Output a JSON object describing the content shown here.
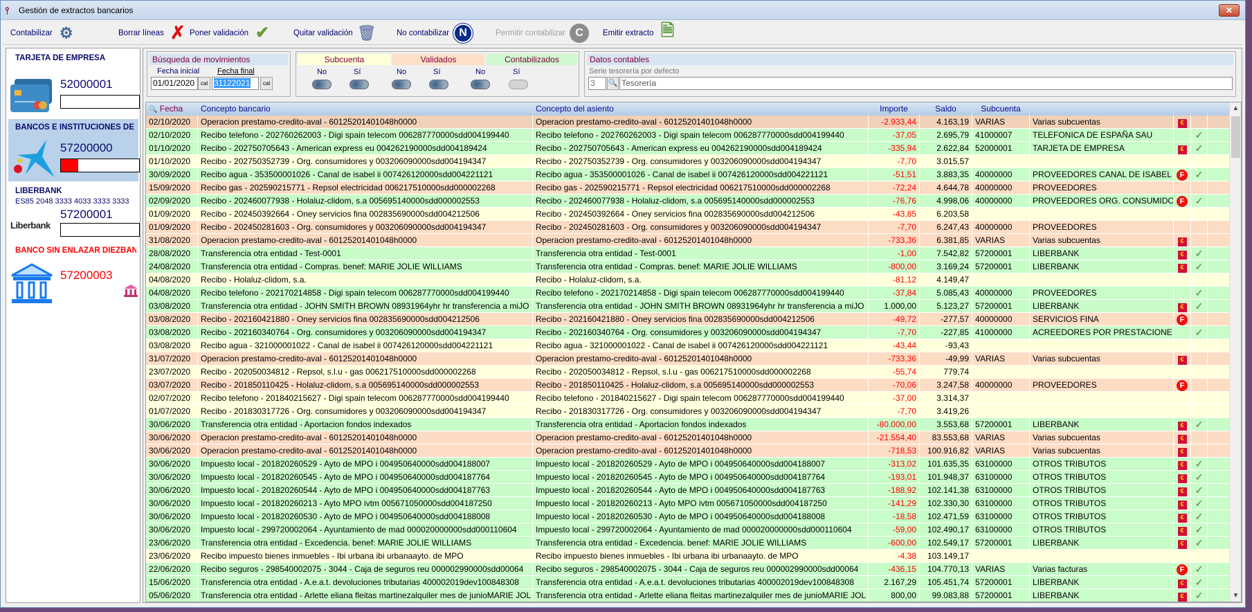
{
  "window": {
    "title": "Gestión de extractos bancarios",
    "close": "✕"
  },
  "toolbar": [
    {
      "label": "Contabilizar",
      "icon": "gears-icon",
      "glyph": "⚙"
    },
    {
      "label": "Borrar líneas",
      "icon": "red-x-icon",
      "glyph": "✗"
    },
    {
      "label": "Poner validación",
      "icon": "check-icon",
      "glyph": "✔"
    },
    {
      "label": "Quitar validación",
      "icon": "trash-icon",
      "glyph": "🗑"
    },
    {
      "label": "No contabilizar",
      "icon": "n-circle-icon",
      "glyph": "N"
    },
    {
      "label": "Permitir contabilizar",
      "icon": "c-circle-icon",
      "glyph": "C",
      "disabled": true
    },
    {
      "label": "Emitir extracto",
      "icon": "document-icon",
      "glyph": "🗎"
    }
  ],
  "accounts": [
    {
      "name": "TARJETA DE EMPRESA",
      "number": "52000001",
      "progress": 0
    },
    {
      "name": "BANCOS E INSTITUCIONES DE CRI",
      "number": "57200000",
      "progress": 0.22
    },
    {
      "name": "LIBERBANK",
      "iban": "ES85 2048 3333 4033 3333 3333",
      "number": "57200001",
      "logo": "Liberbank",
      "progress": 0
    },
    {
      "name": "BANCO SIN ENLAZAR DIEZBANK",
      "number": "57200003"
    }
  ],
  "search": {
    "title": "Búsqueda de movimientos",
    "start_label": "Fecha inicial",
    "start": "01/01/2020",
    "end_label": "Fecha final",
    "end": "31122021",
    "cal": "cal"
  },
  "filters": {
    "subcuenta": "Subcuenta",
    "validados": "Validados",
    "contabilizados": "Contabilizados",
    "no": "No",
    "si": "Sí"
  },
  "datos": {
    "title": "Datos contables",
    "serie_label": "Serie tesorería por defecto",
    "serie": "3",
    "serie_name": "Tesorería"
  },
  "columns": [
    "Fecha",
    "Concepto bancario",
    "Concepto del asiento",
    "Importe",
    "Saldo",
    "Subcuenta"
  ],
  "rows": [
    [
      "02/10/2020",
      "Operacion prestamo-credito-aval - 60125201401048h0000",
      "-2.933,44",
      "4.163,19",
      "VARIAS",
      "Varias subcuentas",
      "E",
      "",
      "selrow"
    ],
    [
      "02/10/2020",
      "Recibo telefono - 202760262003 - Digi spain telecom 006287770000sdd004199440",
      "-37,05",
      "2.695,79",
      "41000007",
      "TELEFONICA DE ESPAÑA SAU",
      "",
      "1",
      "green"
    ],
    [
      "01/10/2020",
      "Recibo - 202750705643 - American express eu 004262190000sdd004189424",
      "-335,94",
      "2.622,84",
      "52000001",
      "TARJETA DE EMPRESA",
      "E",
      "1",
      "green"
    ],
    [
      "01/10/2020",
      "Recibo - 202750352739 - Org. consumidores y 003206090000sdd004194347",
      "-7,70",
      "3.015,57",
      "",
      "",
      "",
      "",
      "yellow"
    ],
    [
      "30/09/2020",
      "Recibo agua - 353500001026 - Canal de isabel ii 007426120000sdd004221121",
      "-51,51",
      "3.883,35",
      "40000000",
      "PROVEEDORES CANAL DE ISABEL II",
      "F",
      "1",
      "green"
    ],
    [
      "15/09/2020",
      "Recibo gas - 202590215771 - Repsol electricidad 006217510000sdd000002268",
      "-72,24",
      "4.644,78",
      "40000000",
      "PROVEEDORES",
      "",
      "",
      "orange"
    ],
    [
      "02/09/2020",
      "Recibo - 202460077938 - Holaluz-clidom, s.a 005695140000sdd000002553",
      "-76,76",
      "4.998,06",
      "40000000",
      "PROVEEDORES ORG. CONSUMIDORES",
      "F",
      "1",
      "green"
    ],
    [
      "01/09/2020",
      "Recibo - 202450392664 - Oney servicios fina 002835690000sdd004212506",
      "-43,85",
      "6.203,58",
      "",
      "",
      "",
      "",
      "yellow"
    ],
    [
      "01/09/2020",
      "Recibo - 202450281603 - Org. consumidores y 003206090000sdd004194347",
      "-7,70",
      "6.247,43",
      "40000000",
      "PROVEEDORES",
      "",
      "",
      "orange"
    ],
    [
      "31/08/2020",
      "Operacion prestamo-credito-aval - 60125201401048h0000",
      "-733,36",
      "6.381,85",
      "VARIAS",
      "Varias subcuentas",
      "E",
      "",
      "orange"
    ],
    [
      "28/08/2020",
      "Transferencia otra entidad - Test-0001",
      "-1,00",
      "7.542,82",
      "57200001",
      "LIBERBANK",
      "E",
      "1",
      "green"
    ],
    [
      "24/08/2020",
      "Transferencia otra entidad - Compras. benef: MARIE JOLIE WILLIAMS",
      "-800,00",
      "3.169,24",
      "57200001",
      "LIBERBANK",
      "E",
      "1",
      "green"
    ],
    [
      "04/08/2020",
      "Recibo - Holaluz-clidom, s.a.",
      "-81,12",
      "4.149,47",
      "",
      "",
      "",
      "",
      "yellow"
    ],
    [
      "04/08/2020",
      "Recibo telefono - 202170214858 - Digi spain telecom 006287770000sdd004199440",
      "-37,84",
      "5.085,43",
      "40000000",
      "PROVEEDORES",
      "",
      "1",
      "green"
    ],
    [
      "03/08/2020",
      "Transferencia otra entidad - JOHN SMITH BROWN 08931964yhr hr transferencia a miJO",
      "1.000,00",
      "5.123,27",
      "57200001",
      "LIBERBANK",
      "E",
      "1",
      "green"
    ],
    [
      "03/08/2020",
      "Recibo - 202160421880 - Oney servicios fina 002835690000sdd004212506",
      "-49,72",
      "-277,57",
      "40000000",
      "SERVICIOS FINA",
      "F",
      "",
      "orange"
    ],
    [
      "03/08/2020",
      "Recibo - 202160340764 - Org. consumidores y 003206090000sdd004194347",
      "-7,70",
      "-227,85",
      "41000000",
      "ACREEDORES POR PRESTACIONES DE S",
      "",
      "1",
      "green"
    ],
    [
      "03/08/2020",
      "Recibo agua - 321000001022 - Canal de isabel ii 007426120000sdd004221121",
      "-43,44",
      "-93,43",
      "",
      "",
      "",
      "",
      "yellow"
    ],
    [
      "31/07/2020",
      "Operacion prestamo-credito-aval - 60125201401048h0000",
      "-733,36",
      "-49,99",
      "VARIAS",
      "Varias subcuentas",
      "E",
      "",
      "orange"
    ],
    [
      "23/07/2020",
      "Recibo - 202050034812 - Repsol, s.l.u - gas 006217510000sdd000002268",
      "-55,74",
      "779,74",
      "",
      "",
      "",
      "",
      "yellow"
    ],
    [
      "03/07/2020",
      "Recibo - 201850110425 - Holaluz-clidom, s.a 005695140000sdd000002553",
      "-70,06",
      "3.247,58",
      "40000000",
      "PROVEEDORES",
      "F",
      "",
      "orange"
    ],
    [
      "02/07/2020",
      "Recibo telefono - 201840215627 - Digi spain telecom 006287770000sdd004199440",
      "-37,00",
      "3.314,37",
      "",
      "",
      "",
      "",
      "yellow"
    ],
    [
      "01/07/2020",
      "Recibo - 201830317726 - Org. consumidores y 003206090000sdd004194347",
      "-7,70",
      "3.419,26",
      "",
      "",
      "",
      "",
      "yellow"
    ],
    [
      "30/06/2020",
      "Transferencia otra entidad - Aportacion fondos indexados",
      "-80.000,00",
      "3.553,68",
      "57200001",
      "LIBERBANK",
      "E",
      "1",
      "green"
    ],
    [
      "30/06/2020",
      "Operacion prestamo-credito-aval - 60125201401048h0000",
      "-21.554,40",
      "83.553,68",
      "VARIAS",
      "Varias subcuentas",
      "E",
      "",
      "orange"
    ],
    [
      "30/06/2020",
      "Operacion prestamo-credito-aval - 60125201401048h0000",
      "-718,53",
      "100.916,82",
      "VARIAS",
      "Varias subcuentas",
      "E",
      "",
      "orange"
    ],
    [
      "30/06/2020",
      "Impuesto local - 201820260529 - Ayto de MPO i 004950640000sdd004188007",
      "-313,02",
      "101.635,35",
      "63100000",
      "OTROS TRIBUTOS",
      "E",
      "1",
      "green"
    ],
    [
      "30/06/2020",
      "Impuesto local - 201820260545 - Ayto de MPO i 004950640000sdd004187764",
      "-193,01",
      "101.948,37",
      "63100000",
      "OTROS TRIBUTOS",
      "E",
      "1",
      "green"
    ],
    [
      "30/06/2020",
      "Impuesto local - 201820260544 - Ayto de MPO i 004950640000sdd004187763",
      "-188,92",
      "102.141,38",
      "63100000",
      "OTROS TRIBUTOS",
      "E",
      "1",
      "green"
    ],
    [
      "30/06/2020",
      "Impuesto local - 201820260213 - Ayto MPO ivtm 005671050000sdd004187250",
      "-141,29",
      "102.330,30",
      "63100000",
      "OTROS TRIBUTOS",
      "E",
      "1",
      "green"
    ],
    [
      "30/06/2020",
      "Impuesto local - 201820260530 - Ayto de MPO i 004950640000sdd004188008",
      "-18,58",
      "102.471,59",
      "63100000",
      "OTROS TRIBUTOS",
      "E",
      "1",
      "green"
    ],
    [
      "30/06/2020",
      "Impuesto local - 299720002064 - Ayuntamiento de mad 000020000000sdd000110604",
      "-59,00",
      "102.490,17",
      "63100000",
      "OTROS TRIBUTOS",
      "E",
      "1",
      "green"
    ],
    [
      "23/06/2020",
      "Transferencia otra entidad - Excedencia. benef: MARIE JOLIE WILLIAMS",
      "-600,00",
      "102.549,17",
      "57200001",
      "LIBERBANK",
      "E",
      "1",
      "green"
    ],
    [
      "23/06/2020",
      "Recibo impuesto bienes inmuebles - Ibi urbana ibi urbanaayto. de MPO",
      "-4,38",
      "103.149,17",
      "",
      "",
      "",
      "",
      "yellow"
    ],
    [
      "22/06/2020",
      "Recibo seguros - 298540002075 - 3044 - Caja de seguros reu 000002990000sdd00064",
      "-436,15",
      "104.770,13",
      "VARIAS",
      "Varias facturas",
      "F",
      "1",
      "green"
    ],
    [
      "15/06/2020",
      "Transferencia otra entidad - A.e.a.t. devoluciones tributarias 400002019dev100848308",
      "2.167,29",
      "105.451,74",
      "57200001",
      "LIBERBANK",
      "E",
      "1",
      "green"
    ],
    [
      "05/06/2020",
      "Transferencia otra entidad - Arlette eliana fleitas martinezalquiler mes de junioMARIE JOL",
      "800,00",
      "99.083,88",
      "57200001",
      "LIBERBANK",
      "E",
      "1",
      "green"
    ]
  ]
}
